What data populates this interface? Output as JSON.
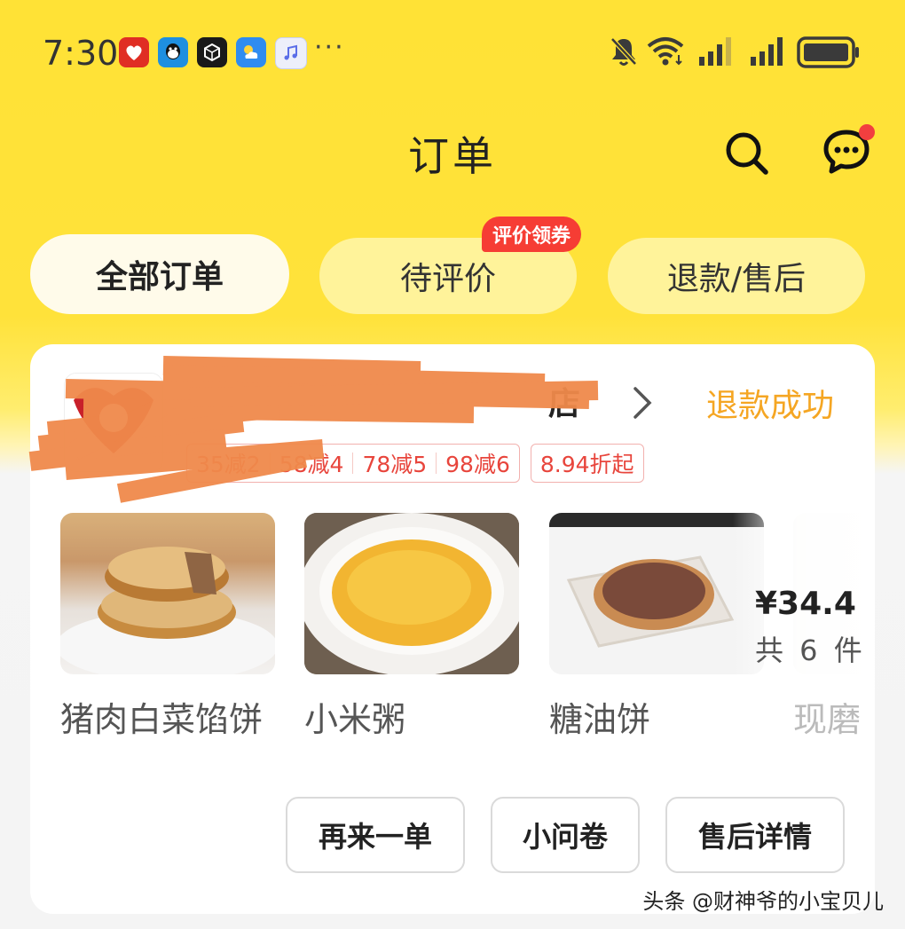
{
  "status_bar": {
    "time": "7:30",
    "app_icons": [
      "pinduoduo-icon",
      "qq-icon",
      "cube-app-icon",
      "weather-icon",
      "music-icon"
    ],
    "more": "···",
    "indicators": [
      "mute-bell-icon",
      "wifi-icon",
      "signal-1-icon",
      "signal-2-icon",
      "battery-icon"
    ]
  },
  "header": {
    "title": "订单",
    "icons": [
      "search-icon",
      "message-icon"
    ]
  },
  "tabs": [
    {
      "label": "全部订单",
      "active": true
    },
    {
      "label": "待评价",
      "active": false,
      "badge": "评价领券"
    },
    {
      "label": "退款/售后",
      "active": false
    }
  ],
  "order": {
    "store_name_visible": "店",
    "status": "退款成功",
    "discounts": [
      "35减2",
      "58减4",
      "78减5",
      "98减6"
    ],
    "discount_extra": "8.94折起",
    "items": [
      {
        "name": "猪肉白菜馅饼",
        "image": "pork-cabbage-pie-photo"
      },
      {
        "name": "小米粥",
        "image": "millet-porridge-photo"
      },
      {
        "name": "糖油饼",
        "image": "sugar-oil-cake-photo"
      },
      {
        "name": "现磨",
        "image": "fourth-item-photo"
      }
    ],
    "price": "¥34.4",
    "quantity": "共 6 件",
    "actions": {
      "reorder": "再来一单",
      "survey": "小问卷",
      "aftersale": "售后详情"
    }
  },
  "watermark": "头条 @财神爷的小宝贝儿",
  "colors": {
    "brand_yellow": "#FFE236",
    "status_orange": "#F5A623",
    "discount_red": "#E8453C",
    "badge_red": "#F63D34"
  }
}
